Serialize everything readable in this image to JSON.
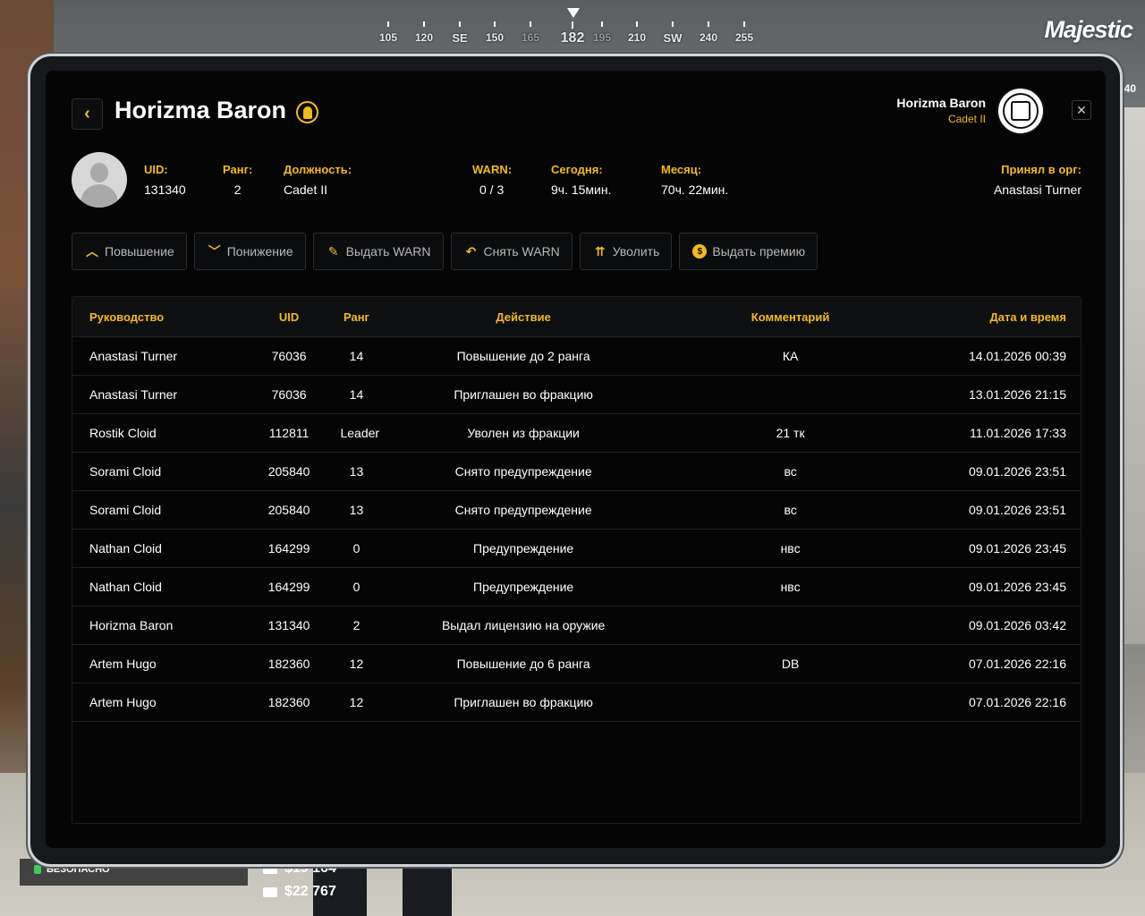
{
  "hud": {
    "compass": [
      "105",
      "120",
      "SE",
      "150",
      "165",
      "182",
      "195",
      "210",
      "SW",
      "240",
      "255"
    ],
    "brand": "Majestic",
    "side_number": "40",
    "zone_label": "БЕЗОПАСНО",
    "money_cash": "$19 164",
    "money_bank": "$22 767"
  },
  "header": {
    "back_icon": "chevron-left-icon",
    "title": "Horizma Baron",
    "user_name": "Horizma Baron",
    "user_rank": "Cadet II",
    "close_symbol": "✕"
  },
  "stats": {
    "uid_label": "UID:",
    "uid_value": "131340",
    "rank_label": "Ранг:",
    "rank_value": "2",
    "position_label": "Должность:",
    "position_value": "Cadet II",
    "warn_label": "WARN:",
    "warn_value": "0 / 3",
    "today_label": "Сегодня:",
    "today_value": "9ч. 15мин.",
    "month_label": "Месяц:",
    "month_value": "70ч. 22мин.",
    "hired_label": "Принял в орг:",
    "hired_value": "Anastasi Turner"
  },
  "actions": [
    {
      "label": "Повышение",
      "icon": "chevron-up-icon"
    },
    {
      "label": "Понижение",
      "icon": "chevron-down-icon"
    },
    {
      "label": "Выдать WARN",
      "icon": "document-edit-icon"
    },
    {
      "label": "Снять WARN",
      "icon": "undo-arrow-icon"
    },
    {
      "label": "Уволить",
      "icon": "fire-person-icon"
    },
    {
      "label": "Выдать премию",
      "icon": "dollar-coin-icon"
    }
  ],
  "table": {
    "headers": [
      "Руководство",
      "UID",
      "Ранг",
      "Действие",
      "Комментарий",
      "Дата и время"
    ],
    "rows": [
      [
        "Anastasi Turner",
        "76036",
        "14",
        "Повышение до 2 ранга",
        "КА",
        "14.01.2026 00:39"
      ],
      [
        "Anastasi Turner",
        "76036",
        "14",
        "Приглашен во фракцию",
        "",
        "13.01.2026 21:15"
      ],
      [
        "Rostik Cloid",
        "112811",
        "Leader",
        "Уволен из фракции",
        "21 тк",
        "11.01.2026 17:33"
      ],
      [
        "Sorami Cloid",
        "205840",
        "13",
        "Снято предупреждение",
        "вс",
        "09.01.2026 23:51"
      ],
      [
        "Sorami Cloid",
        "205840",
        "13",
        "Снято предупреждение",
        "вс",
        "09.01.2026 23:51"
      ],
      [
        "Nathan Cloid",
        "164299",
        "0",
        "Предупреждение",
        "нвс",
        "09.01.2026 23:45"
      ],
      [
        "Nathan Cloid",
        "164299",
        "0",
        "Предупреждение",
        "нвс",
        "09.01.2026 23:45"
      ],
      [
        "Horizma Baron",
        "131340",
        "2",
        "Выдал лицензию на оружие",
        "",
        "09.01.2026 03:42"
      ],
      [
        "Artem Hugo",
        "182360",
        "12",
        "Повышение до 6 ранга",
        "DB",
        "07.01.2026 22:16"
      ],
      [
        "Artem Hugo",
        "182360",
        "12",
        "Приглашен во фракцию",
        "",
        "07.01.2026 22:16"
      ]
    ]
  },
  "colors": {
    "accent": "#f5b91e",
    "panel": "#050505",
    "row_divider": "#1f2124"
  }
}
